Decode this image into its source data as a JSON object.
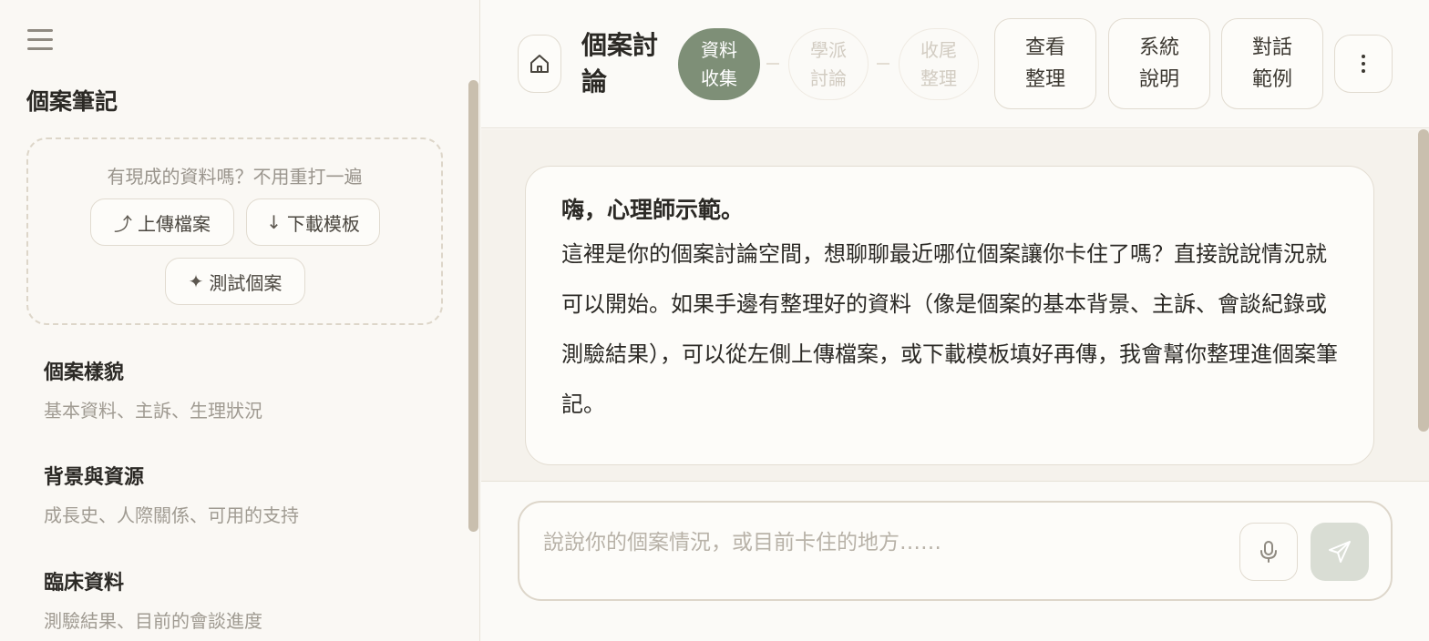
{
  "sidebar": {
    "title": "個案筆記",
    "upload": {
      "hint": "有現成的資料嗎？不用重打一遍",
      "upload_icon": "⤴",
      "upload_label": "上傳檔案",
      "download_icon": "↓",
      "download_label": "下載模板",
      "test_icon": "✦",
      "test_label": "測試個案"
    },
    "sections": [
      {
        "title": "個案樣貌",
        "subtitle": "基本資料、主訴、生理狀況"
      },
      {
        "title": "背景與資源",
        "subtitle": "成長史、人際關係、可用的支持"
      },
      {
        "title": "臨床資料",
        "subtitle": "測驗結果、目前的會談進度"
      }
    ]
  },
  "header": {
    "title": "個案討論",
    "steps": [
      {
        "label": "資料收集",
        "state": "active"
      },
      {
        "label": "學派討論",
        "state": "inactive"
      },
      {
        "label": "收尾整理",
        "state": "inactive"
      }
    ],
    "tools": [
      {
        "label": "查看整理"
      },
      {
        "label": "系統說明"
      },
      {
        "label": "對話範例"
      }
    ]
  },
  "chat": {
    "greeting": "嗨，心理師示範。",
    "body": "這裡是你的個案討論空間，想聊聊最近哪位個案讓你卡住了嗎？直接說說情況就可以開始。如果手邊有整理好的資料（像是個案的基本背景、主訴、會談紀錄或測驗結果），可以從左側上傳檔案，或下載模板填好再傳，我會幫你整理進個案筆記。"
  },
  "composer": {
    "placeholder": "說說你的個案情況，或目前卡住的地方……",
    "value": ""
  },
  "colors": {
    "accent": "#7e8f77",
    "scrollbar": "#c9bfae",
    "send_disabled": "#d9ddd4",
    "border": "#e1dbd0"
  },
  "icons": {
    "menu": "hamburger-menu-icon",
    "home": "home-icon",
    "more": "more-vertical-icon",
    "mic": "microphone-icon",
    "send": "send-icon"
  }
}
